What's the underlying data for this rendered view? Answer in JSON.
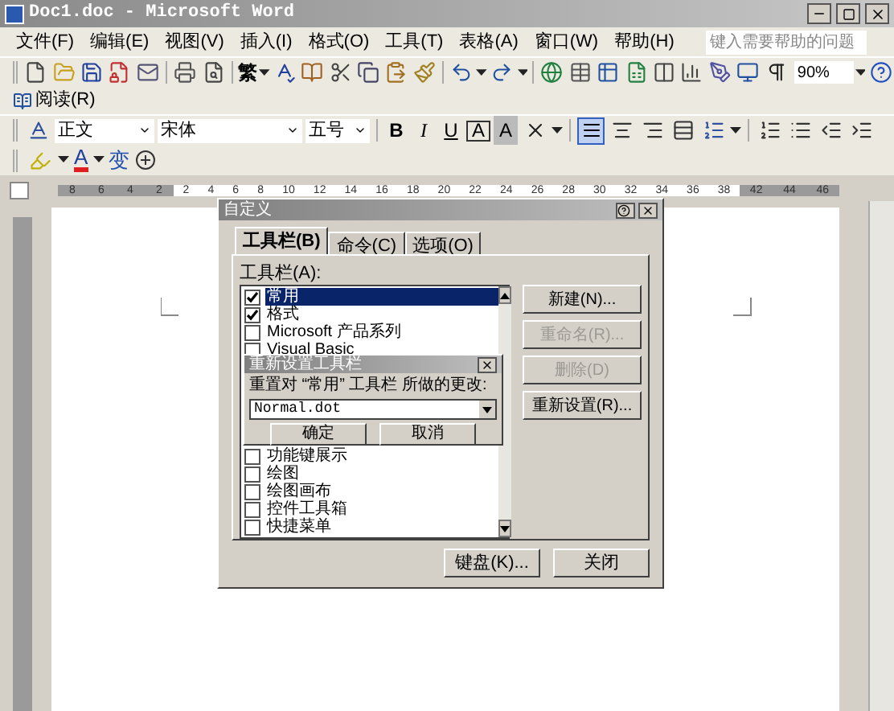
{
  "window": {
    "title": "Doc1.doc - Microsoft Word"
  },
  "menu": [
    "文件(F)",
    "编辑(E)",
    "视图(V)",
    "插入(I)",
    "格式(O)",
    "工具(T)",
    "表格(A)",
    "窗口(W)",
    "帮助(H)"
  ],
  "help_box": {
    "placeholder": "键入需要帮助的问题"
  },
  "standard_toolbar": {
    "convert_glyph": "繁",
    "zoom": "90%"
  },
  "reading_toolbar": {
    "label": "阅读(R)"
  },
  "format_toolbar": {
    "style": "正文",
    "font": "宋体",
    "size": "五号",
    "char_buttons": [
      {
        "kind": "bold",
        "text": "B"
      },
      {
        "kind": "italic",
        "text": "I"
      },
      {
        "kind": "underline",
        "text": "U"
      },
      {
        "kind": "border",
        "text": "A"
      },
      {
        "kind": "shading",
        "text": "A"
      }
    ]
  },
  "extra_toolbar": {
    "font_color_glyph": "A",
    "phonetic_glyph": "变"
  },
  "ruler": {
    "left_numbers": [
      "8",
      "6",
      "4",
      "2"
    ],
    "numbers": [
      "2",
      "4",
      "6",
      "8",
      "10",
      "12",
      "14",
      "16",
      "18",
      "20",
      "22",
      "24",
      "26",
      "28",
      "30",
      "32",
      "34",
      "36",
      "38"
    ],
    "right_numbers": [
      "42",
      "44",
      "46"
    ]
  },
  "customize_dialog": {
    "title": "自定义",
    "tabs": [
      {
        "label": "工具栏(B)",
        "selected": true
      },
      {
        "label": "命令(C)",
        "selected": false
      },
      {
        "label": "选项(O)",
        "selected": false
      }
    ],
    "list_label": "工具栏(A):",
    "items_top": [
      {
        "label": "常用",
        "checked": true,
        "selected": true
      },
      {
        "label": "格式",
        "checked": true,
        "selected": false
      },
      {
        "label": "Microsoft 产品系列",
        "checked": false,
        "selected": false
      },
      {
        "label": "Visual Basic",
        "checked": false,
        "selected": false
      }
    ],
    "items_bottom": [
      {
        "label": "功能键展示",
        "checked": false,
        "selected": false
      },
      {
        "label": "绘图",
        "checked": false,
        "selected": false
      },
      {
        "label": "绘图画布",
        "checked": false,
        "selected": false
      },
      {
        "label": "控件工具箱",
        "checked": false,
        "selected": false
      },
      {
        "label": "快捷菜单",
        "checked": false,
        "selected": false
      }
    ],
    "side_buttons": [
      {
        "label": "新建(N)...",
        "disabled": false
      },
      {
        "label": "重命名(R)...",
        "disabled": true
      },
      {
        "label": "删除(D)",
        "disabled": true
      },
      {
        "label": "重新设置(R)...",
        "disabled": false
      }
    ],
    "bottom_buttons": [
      "键盘(K)...",
      "关闭"
    ]
  },
  "reset_dialog": {
    "title": "重新设置工具栏",
    "prompt": "重置对 “常用” 工具栏 所做的更改:",
    "target": "Normal.dot",
    "buttons": [
      "确定",
      "取消"
    ]
  }
}
